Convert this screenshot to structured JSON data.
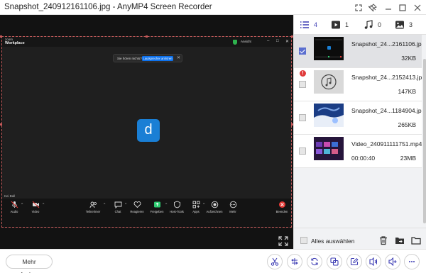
{
  "window": {
    "title": "Snapshot_240912161106.jpg  -  AnyMP4 Screen Recorder"
  },
  "zoom": {
    "logo_small": "zoom",
    "logo_big": "Workplace",
    "view_label": "Ansicht",
    "banner_question": "Sie hören nichts?",
    "banner_button": "Lautsprecher anhören",
    "avatar_letter": "d",
    "participant_name": "Kei Ball",
    "toolbar": [
      "Audio",
      "Video",
      "Teilnehmer",
      "Chat",
      "Reagieren",
      "Freigeben",
      "Host-Tools",
      "Apps",
      "Aufzeichnen",
      "Mehr",
      "Beenden"
    ],
    "colors": {
      "share": "#2ecc71",
      "end": "#e53935",
      "avatar": "#1a7fd5"
    }
  },
  "tabs": [
    {
      "icon": "list-icon",
      "count": "4"
    },
    {
      "icon": "video-icon",
      "count": "1"
    },
    {
      "icon": "audio-icon",
      "count": "0"
    },
    {
      "icon": "image-icon",
      "count": "3"
    }
  ],
  "files": [
    {
      "name": "Snapshot_24...2161106.jpg",
      "size": "32KB",
      "selected": true
    },
    {
      "name": "Snapshot_24...2152413.jpg",
      "size": "147KB",
      "warning": true
    },
    {
      "name": "Snapshot_24...1184904.jpg",
      "size": "265KB"
    },
    {
      "name": "Video_240911111751.mp4",
      "duration": "00:00:40",
      "size": "23MB"
    }
  ],
  "select_all_label": "Alles auswählen",
  "more_recording_label": "Mehr aufnehmen",
  "accent_color": "#3b3bb3"
}
